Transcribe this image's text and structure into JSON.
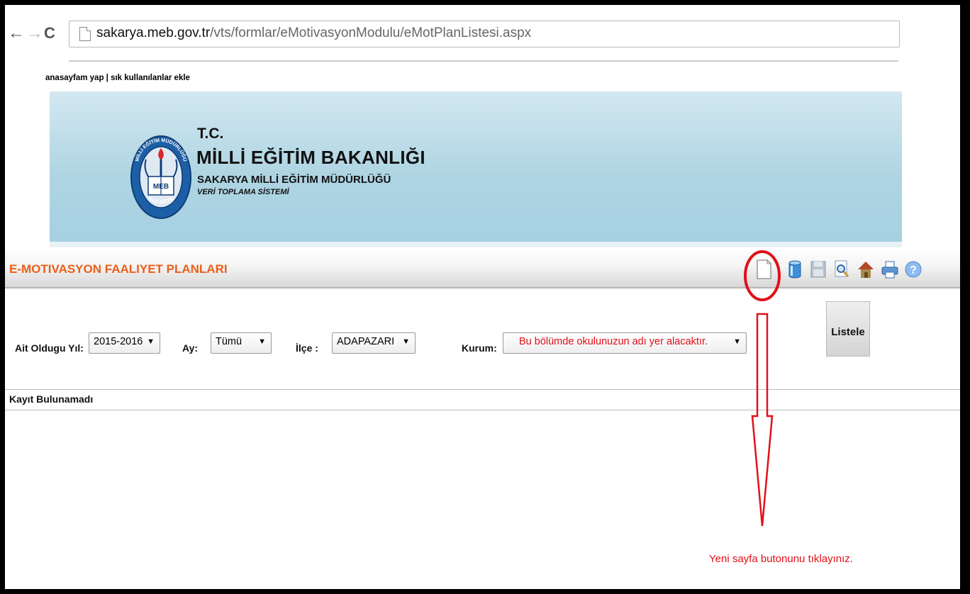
{
  "browser": {
    "url_domain": "sakarya.meb.gov.tr",
    "url_path": "/vts/formlar/eMotivasyonModulu/eMotPlanListesi.aspx"
  },
  "top_links": "anasayfam yap | sık kullanılanlar ekle",
  "banner": {
    "tc": "T.C.",
    "ministry": "MİLLİ EĞİTİM BAKANLIĞI",
    "directorate": "SAKARYA MİLLİ EĞİTİM MÜDÜRLÜĞÜ",
    "system": "VERİ TOPLAMA SİSTEMİ",
    "logo_inner": "MEB",
    "logo_ring_top": "MİLLİ EĞİTİM MÜDÜRLÜĞÜ",
    "logo_ring_bottom": "SAKARYA"
  },
  "module": {
    "title": "E-MOTIVASYON FAALIYET PLANLARI",
    "toolbar_icons": [
      "new-page-icon",
      "database-icon",
      "save-icon",
      "preview-icon",
      "home-icon",
      "print-icon",
      "help-icon"
    ]
  },
  "filters": {
    "year_label": "Ait Oldugu Yıl:",
    "year_value": "2015-2016",
    "month_label": "Ay:",
    "month_value": "Tümü",
    "district_label": "İlçe :",
    "district_value": "ADAPAZARI",
    "institution_label": "Kurum:",
    "institution_value": "Bu bölümde okulunuzun adı yer alacaktır."
  },
  "list_button": "Listele",
  "result_text": "Kayıt Bulunamadı",
  "annotation_note": "Yeni sayfa butonunu tıklayınız.",
  "colors": {
    "module_title": "#e8601a",
    "annotation_red": "#e2101a",
    "banner_blue": "#afd5e3"
  }
}
